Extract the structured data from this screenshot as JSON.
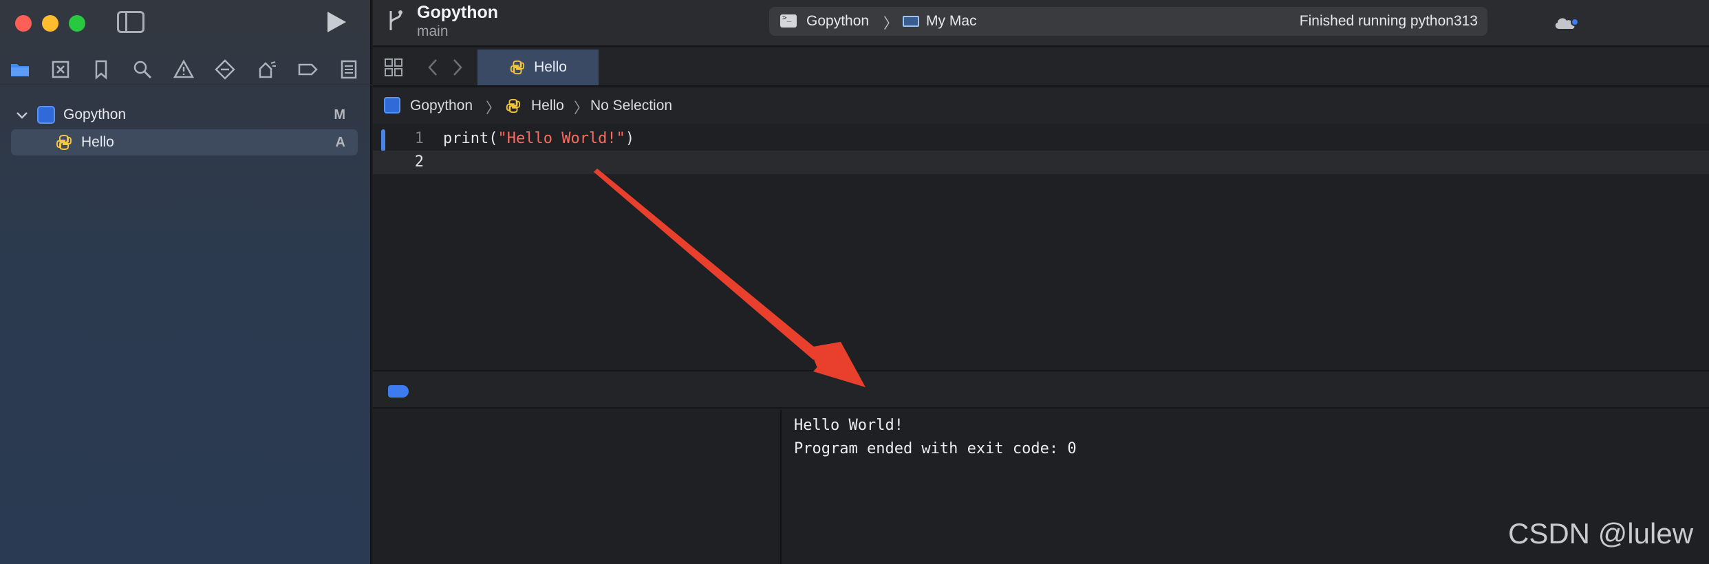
{
  "window": {
    "project_title": "Gopython",
    "branch": "main"
  },
  "activity": {
    "scheme": "Gopython",
    "separator": "〉",
    "destination": "My Mac",
    "status": "Finished running python313"
  },
  "navigator": {
    "icons": [
      "folder-icon",
      "source-control-icon",
      "bookmark-icon",
      "search-icon",
      "warning-icon",
      "test-icon",
      "debug-icon",
      "breakpoint-icon",
      "report-icon"
    ],
    "items": [
      {
        "label": "Gopython",
        "badge": "M"
      },
      {
        "label": "Hello",
        "badge": "A"
      }
    ]
  },
  "tabs": [
    {
      "label": "Hello"
    }
  ],
  "jumpbar": {
    "project": "Gopython",
    "sep": "〉",
    "file": "Hello",
    "selection": "No Selection"
  },
  "editor": {
    "lines": [
      {
        "num": "1",
        "prefix": "print(",
        "string": "\"Hello World!\"",
        "suffix": ")"
      },
      {
        "num": "2",
        "prefix": "",
        "string": "",
        "suffix": ""
      }
    ]
  },
  "console": {
    "lines": [
      "Hello World!",
      "Program ended with exit code: 0"
    ]
  },
  "watermark": "CSDN @lulew",
  "colors": {
    "accent": "#3d7cf0",
    "annotation_arrow": "#e8402c",
    "string_literal": "#fc6a5d"
  }
}
